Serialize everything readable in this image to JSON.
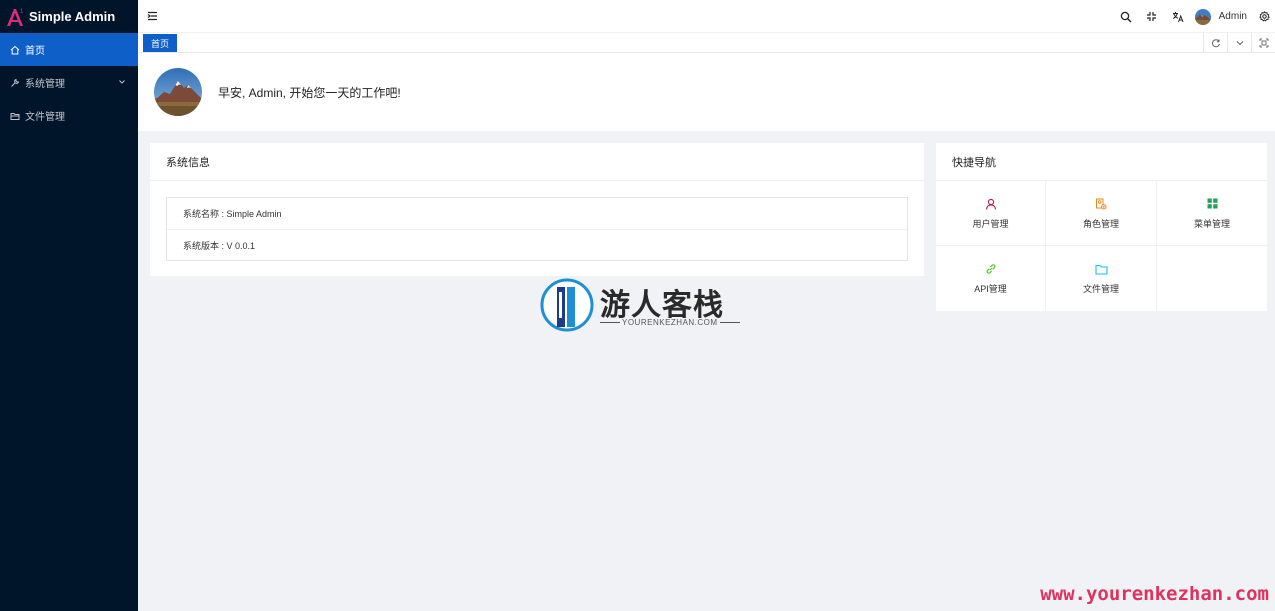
{
  "app": {
    "title": "Simple Admin"
  },
  "sidebar": {
    "items": [
      {
        "label": "首页",
        "icon": "home-icon"
      },
      {
        "label": "系统管理",
        "icon": "wrench-icon"
      },
      {
        "label": "文件管理",
        "icon": "folder-icon"
      }
    ]
  },
  "header": {
    "user_name": "Admin"
  },
  "tabs": [
    {
      "label": "首页"
    }
  ],
  "greeting": {
    "text": "早安, Admin, 开始您一天的工作吧!"
  },
  "system_info": {
    "title": "系统信息",
    "rows": [
      {
        "text": "系统名称 : Simple Admin"
      },
      {
        "text": "系统版本 : V 0.0.1"
      }
    ]
  },
  "quick_nav": {
    "title": "快捷导航",
    "items": [
      {
        "label": "用户管理",
        "icon": "user-icon",
        "color": "#c0143c"
      },
      {
        "label": "角色管理",
        "icon": "role-icon",
        "color": "#e8891a"
      },
      {
        "label": "菜单管理",
        "icon": "grid-icon",
        "color": "#23a05e"
      },
      {
        "label": "API管理",
        "icon": "link-icon",
        "color": "#52c41a"
      },
      {
        "label": "文件管理",
        "icon": "folder-icon",
        "color": "#13c2e8"
      }
    ]
  },
  "watermark": {
    "title": "游人客栈",
    "subtitle": "YOURENKEZHAN.COM",
    "url": "www.yourenkezhan.com"
  },
  "colors": {
    "sidebar_bg": "#001529",
    "primary": "#0f5fc9",
    "watermark_url": "#e0325e"
  }
}
